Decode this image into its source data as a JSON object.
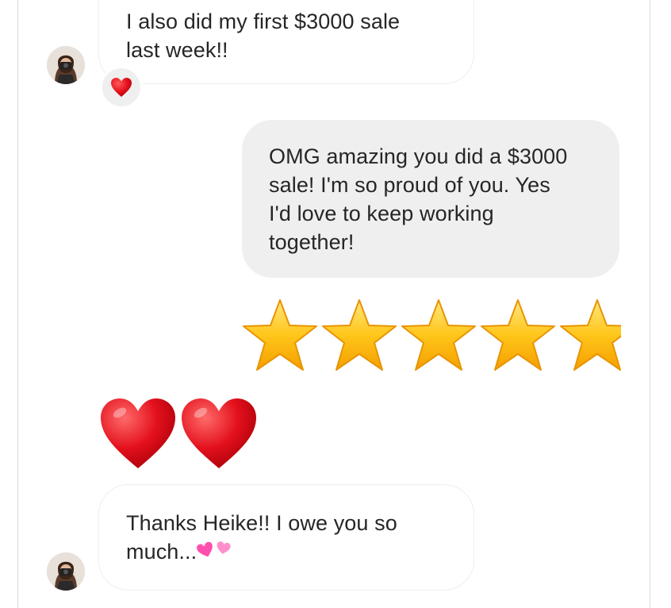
{
  "messages": [
    {
      "id": "msg1",
      "direction": "incoming",
      "line1": "I also did my first $3000 sale",
      "line2": "last week!!",
      "reaction": "heart-icon"
    },
    {
      "id": "msg2",
      "direction": "outgoing",
      "line1": "OMG amazing you did a $3000",
      "line2": "sale! I'm so proud of you. Yes",
      "line3": "I'd love to keep working",
      "line4": "together!"
    },
    {
      "id": "msg3",
      "direction": "outgoing",
      "emoji": "star-icon",
      "emoji_count": 5
    },
    {
      "id": "msg4",
      "direction": "incoming",
      "emoji": "heart-icon",
      "emoji_count": 2
    },
    {
      "id": "msg5",
      "direction": "incoming",
      "line1": "Thanks Heike!! I owe you so",
      "line2": "much...",
      "trailing_emoji": "two-hearts-icon"
    }
  ],
  "colors": {
    "incoming_bubble_border": "#efefef",
    "outgoing_bubble_bg": "#efefef",
    "text": "#262626",
    "heart": "#e0101e",
    "star": "#ffc61a",
    "pink_hearts": "#ff5fb4"
  }
}
